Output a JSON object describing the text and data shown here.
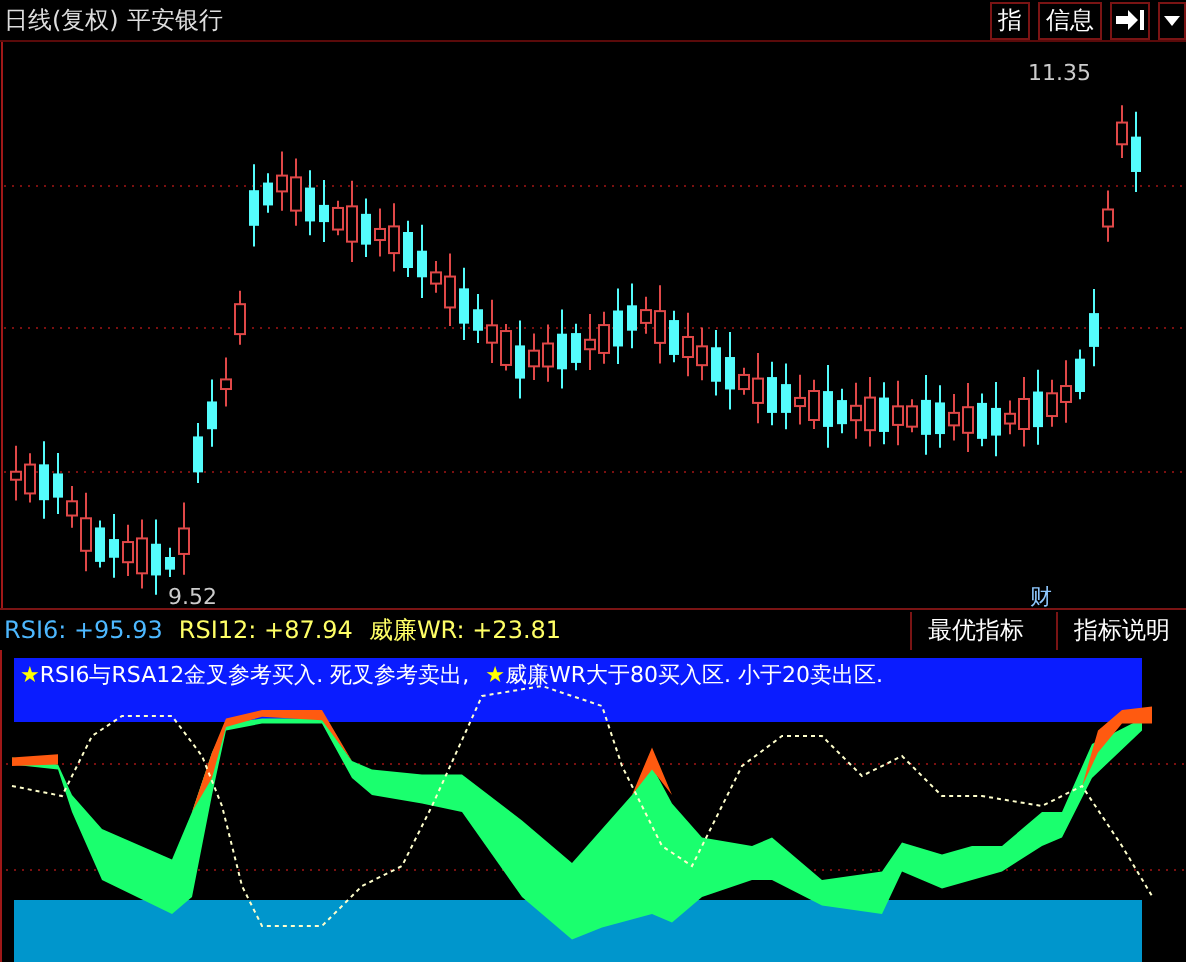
{
  "title_bar": {
    "period": "日线(复权)",
    "stock": "平安银行",
    "buttons": [
      {
        "label": "指"
      },
      {
        "label": "信息"
      }
    ]
  },
  "chart": {
    "high_label": "11.35",
    "low_label": "9.52",
    "marker": "财"
  },
  "indicator": {
    "legend": [
      {
        "label": "RSI6: +95.93",
        "color": "#4db8ff"
      },
      {
        "label": "RSI12: +87.94",
        "color": "#ffff66"
      },
      {
        "label": "威廉WR: +23.81",
        "color": "#ffff66"
      }
    ],
    "buttons": [
      {
        "label": "最优指标"
      },
      {
        "label": "指标说明"
      }
    ],
    "notes": [
      {
        "star": "★",
        "text": "RSI6与RSA12金叉参考买入. 死叉参考卖出,"
      },
      {
        "star": "★",
        "text": "威廉WR大于80买入区. 小于20卖出区."
      }
    ]
  }
}
